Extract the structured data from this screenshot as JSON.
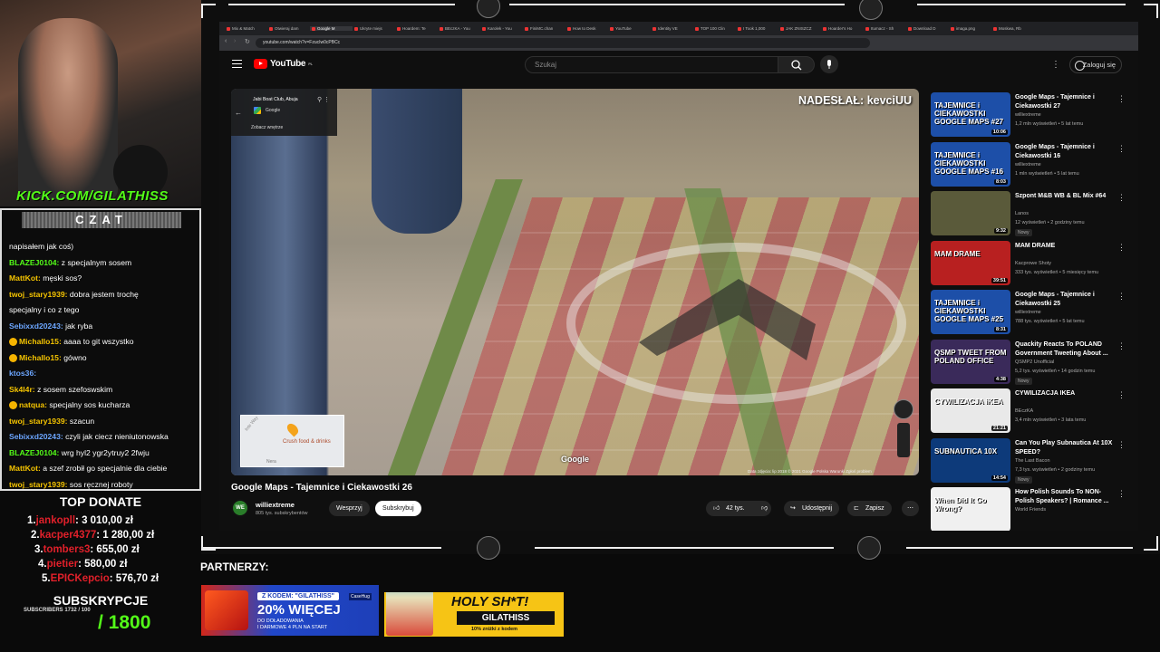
{
  "stream": {
    "kick_url": "KICK.COM/GILATHISS",
    "chat_title": "CZAT",
    "chat": [
      {
        "user": "",
        "color": "#ffffff",
        "text": "napisałem jak coś)",
        "emote": false
      },
      {
        "user": "BLAZEJ0104:",
        "color": "#53fc18",
        "text": "z specjalnym sosem",
        "emote": false
      },
      {
        "user": "MattKot:",
        "color": "#f5c400",
        "text": "męski sos?",
        "emote": false
      },
      {
        "user": "twoj_stary1939:",
        "color": "#f5c400",
        "text": "dobra jestem trochę",
        "emote": false
      },
      {
        "user": "",
        "color": "#ffffff",
        "text": "specjalny i co z tego",
        "emote": false
      },
      {
        "user": "Sebixxd20243:",
        "color": "#6ca6ff",
        "text": "jak ryba",
        "emote": false
      },
      {
        "user": "Michallo15:",
        "color": "#f5c400",
        "text": "aaaa to git wszystko",
        "emote": true
      },
      {
        "user": "Michallo15:",
        "color": "#f5c400",
        "text": "gówno",
        "emote": true
      },
      {
        "user": "ktos36:",
        "color": "#6ca6ff",
        "text": "",
        "emote": false
      },
      {
        "user": "Sk4l4r:",
        "color": "#f5c400",
        "text": "z sosem szefoswskim",
        "emote": false
      },
      {
        "user": "natqua:",
        "color": "#f5c400",
        "text": "specjalny sos kucharza",
        "emote": true
      },
      {
        "user": "twoj_stary1939:",
        "color": "#f5c400",
        "text": "szacun",
        "emote": false
      },
      {
        "user": "Sebixxd20243:",
        "color": "#6ca6ff",
        "text": "czyli jak ciecz nieniutonowska",
        "emote": false
      },
      {
        "user": "BLAZEJ0104:",
        "color": "#53fc18",
        "text": "wrg hyl2 ygr2ytruy2 2fwju",
        "emote": false
      },
      {
        "user": "MattKot:",
        "color": "#f5c400",
        "text": "a szef zrobił go specjalnie dla ciebie",
        "emote": false
      },
      {
        "user": "twoj_stary1939:",
        "color": "#f5c400",
        "text": "sos ręcznej roboty",
        "emote": false
      }
    ],
    "top_donate_title": "TOP DONATE",
    "donors": [
      {
        "rank": "1.",
        "name": "jankopll",
        "amount": ": 3 010,00 zł"
      },
      {
        "rank": "2.",
        "name": "kacper4377",
        "amount": ": 1 280,00 zł"
      },
      {
        "rank": "3.",
        "name": "tombers3",
        "amount": ": 655,00 zł"
      },
      {
        "rank": "4.",
        "name": "pietier",
        "amount": ": 580,00 zł"
      },
      {
        "rank": "5.",
        "name": "EPICKepcio",
        "amount": ": 576,70 zł"
      }
    ],
    "subs_title": "SUBSKRYPCJE",
    "subs_small": "SUBSCRIBERS 1732 / 100",
    "subs_goal": "/ 1800",
    "partners_label": "PARTNERZY:",
    "ad1": {
      "code": "Z KODEM: \"GILATHISS\"",
      "big": "20% WIĘCEJ",
      "line2": "DO DOŁADOWANIA",
      "line3": "I DARMOWE 4 PLN NA START",
      "brand": "CaseHug"
    },
    "ad2": {
      "headline": "HOLY SH*T!",
      "code": "GILATHISS",
      "sub": "10% zniżki z kodem"
    }
  },
  "browser": {
    "tabs": [
      "Mix & Match",
      "Otwieraj dam",
      "Google M",
      "Ukryte miejs",
      "Hoardem: Te",
      "BEczKA - You",
      "Karolek - You",
      "FiniMC.chan",
      "How to Desk",
      "YouTube",
      "Identity VE",
      "TOP 100 Clin",
      "I Took 1,000",
      "JAK ZNISZCZ",
      "Hoarder's Ho",
      "Itumacz - Sh",
      "Download D",
      "imaga.png",
      "Moskwa, Rb"
    ],
    "active_tab": 2,
    "url": "youtube.com/watch?v=FzucIw0cPBCc"
  },
  "youtube": {
    "logo": "YouTube",
    "logo_region": "PL",
    "search_placeholder": "Szukaj",
    "signin": "Zaloguj się",
    "overlay_sender": "NADESŁAŁ: kevciUU",
    "maps_place": "Jabi Boat Club, Abuja",
    "maps_source": "Google",
    "maps_see_inside": "Zobacz wnętrze",
    "minimap_label": "Crush food & drinks",
    "minimap_street": "Nera",
    "minimap_way": "Inte Way",
    "google_watermark": "Google",
    "credits": "Data zdjęcia: lip 2018    © 2021 Google    Polska    Warunki    Zgłoś problem",
    "video_title": "Google Maps - Tajemnice i Ciekawostki 26",
    "channel": "williextreme",
    "channel_avatar": "WE",
    "channel_subs": "805 tys. subskrybentów",
    "join": "Wesprzyj",
    "subscribe": "Subskrybuj",
    "likes": "42 tys.",
    "share": "Udostępnij",
    "save": "Zapisz",
    "recommended": [
      {
        "thumb_text": "TAJEMNICE i CIEKAWOSTKI GOOGLE MAPS #27",
        "thumb_bg": "#1d4fa8",
        "duration": "10:06",
        "title": "Google Maps - Tajemnice i Ciekawostki 27",
        "channel": "williextreme",
        "meta": "1,2 mln wyświetleń • 5 lat temu",
        "badge": ""
      },
      {
        "thumb_text": "TAJEMNICE i CIEKAWOSTKI GOOGLE MAPS #16",
        "thumb_bg": "#1d4fa8",
        "duration": "8:03",
        "title": "Google Maps - Tajemnice i Ciekawostki 16",
        "channel": "williextreme",
        "meta": "1 mln wyświetleń • 5 lat temu",
        "badge": ""
      },
      {
        "thumb_text": "",
        "thumb_bg": "#5a5a3a",
        "duration": "9:32",
        "title": "Szpont M&B WB & BL Mix #64",
        "channel": "Lanos",
        "meta": "12 wyświetleń • 2 godziny temu",
        "badge": "Nowy"
      },
      {
        "thumb_text": "MAM DRAME",
        "thumb_bg": "#b82020",
        "duration": "39:51",
        "title": "MAM DRAME",
        "channel": "Kacprowe Shoty",
        "meta": "333 tys. wyświetleń • 5 miesięcy temu",
        "badge": ""
      },
      {
        "thumb_text": "TAJEMNICE i CIEKAWOSTKI GOOGLE MAPS #25",
        "thumb_bg": "#1d4fa8",
        "duration": "8:31",
        "title": "Google Maps - Tajemnice i Ciekawostki 25",
        "channel": "williextreme",
        "meta": "788 tys. wyświetleń • 5 lat temu",
        "badge": ""
      },
      {
        "thumb_text": "QSMP TWEET FROM POLAND OFFICE",
        "thumb_bg": "#3a2a5a",
        "duration": "4:38",
        "title": "Quackity Reacts To POLAND Government Tweeting About ...",
        "channel": "QSMP2 Unofficial",
        "meta": "5,2 tys. wyświetleń • 14 godzin temu",
        "badge": "Nowy"
      },
      {
        "thumb_text": "CYWILIZACJA iKEA",
        "thumb_bg": "#e9e9e9",
        "duration": "21:21",
        "title": "CYWILIZACJA IKEA",
        "channel": "BEczKA",
        "meta": "3,4 mln wyświetleń • 3 lata temu",
        "badge": ""
      },
      {
        "thumb_text": "SUBNAUTICA 10X",
        "thumb_bg": "#0d3a7a",
        "duration": "14:54",
        "title": "Can You Play Subnautica At 10X SPEED?",
        "channel": "The Last Bacon",
        "meta": "7,3 tys. wyświetleń • 2 godziny temu",
        "badge": "Nowy"
      },
      {
        "thumb_text": "When Did It Go Wrong?",
        "thumb_bg": "#f0f0f0",
        "duration": "",
        "title": "How Polish Sounds To NON-Polish Speakers? | Romance ...",
        "channel": "World Friends",
        "meta": "",
        "badge": ""
      }
    ]
  }
}
